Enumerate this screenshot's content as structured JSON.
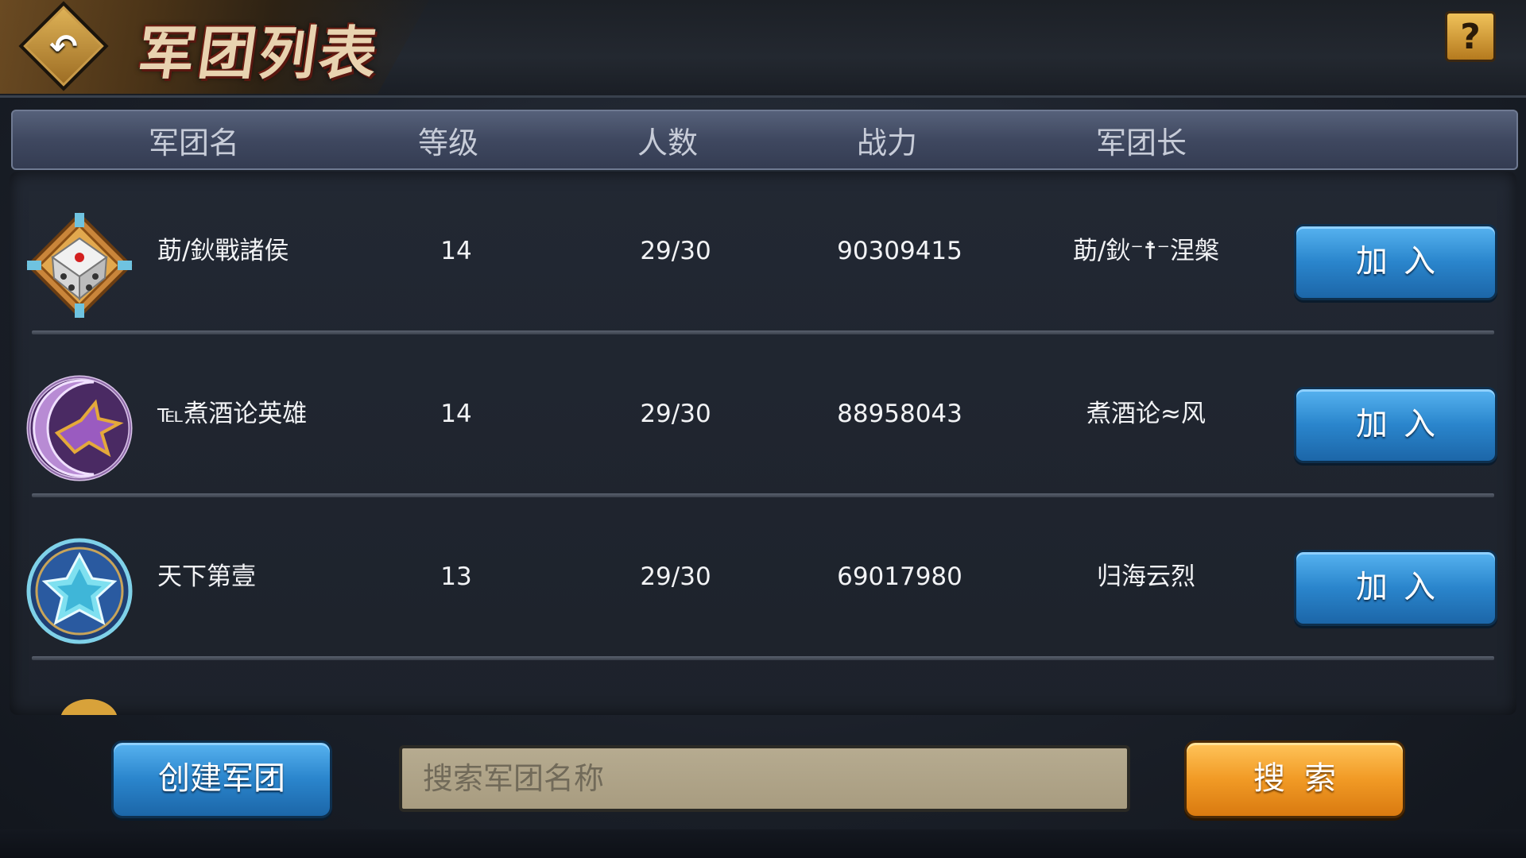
{
  "header": {
    "title": "军团列表",
    "back_icon": "back-arrow-icon",
    "help_label": "?"
  },
  "columns": [
    "军团名",
    "等级",
    "人数",
    "战力",
    "军团长"
  ],
  "rows": [
    {
      "emblem": "dice-emblem-icon",
      "name": "莇/鈥戰諸侯",
      "level": "14",
      "members": "29/30",
      "power": "90309415",
      "leader": "莇/鈥⁻☨⁻涅槃",
      "join_label": "加入"
    },
    {
      "emblem": "crescent-bird-emblem-icon",
      "name": "℡煮酒论英雄",
      "level": "14",
      "members": "29/30",
      "power": "88958043",
      "leader": "煮酒论≈风",
      "join_label": "加入"
    },
    {
      "emblem": "crystal-emblem-icon",
      "name": "天下第壹",
      "level": "13",
      "members": "29/30",
      "power": "69017980",
      "leader": "归海云烈",
      "join_label": "加入"
    }
  ],
  "footer": {
    "create_label": "创建军团",
    "search_placeholder": "搜索军团名称",
    "search_value": "",
    "search_label": "搜索"
  }
}
